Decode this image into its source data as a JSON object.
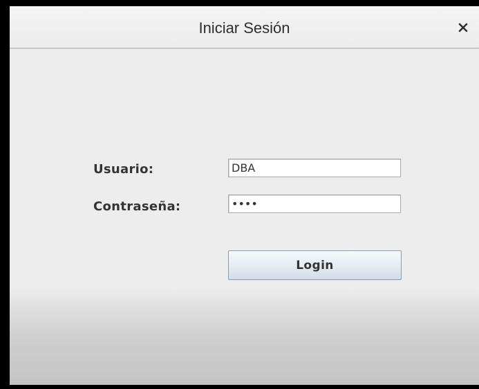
{
  "window": {
    "title": "Iniciar Sesión",
    "close_symbol": "×"
  },
  "form": {
    "user_label": "Usuario:",
    "user_value": "DBA",
    "password_label": "Contraseña:",
    "password_value": "dba1",
    "login_label": "Login"
  },
  "icons": {
    "close": "close-icon"
  },
  "colors": {
    "background": "#ededed",
    "button_top": "#f6f9fc",
    "button_bottom": "#d3dde8",
    "text": "#333333"
  }
}
